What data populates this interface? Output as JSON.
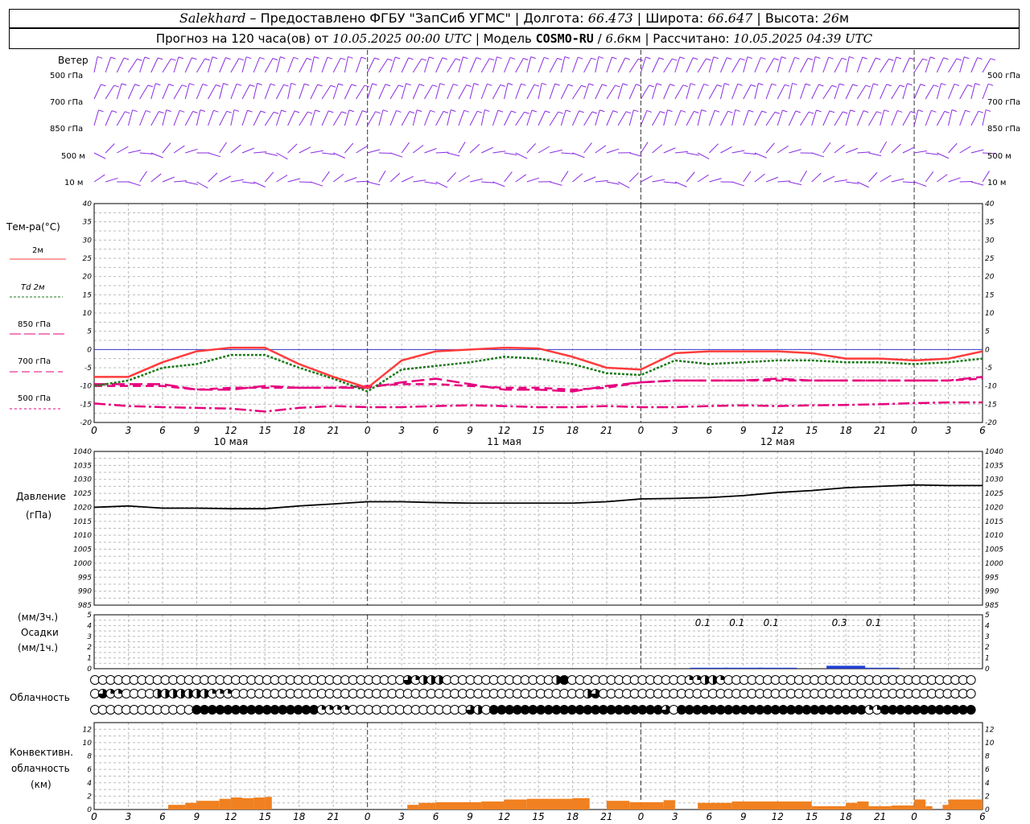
{
  "header": {
    "station": "Salekhard",
    "provider": "– Предоставлено ФГБУ \"ЗапСиб УГМС\"",
    "lon_label": "Долгота:",
    "lon_value": "66.473",
    "lat_label": "Широта:",
    "lat_value": "66.647",
    "alt_label": "Высота:",
    "alt_value": "26",
    "alt_unit": "м",
    "forecast_prefix": "Прогноз на 120 часа(ов) от",
    "forecast_start": "10.05.2025 00:00 UTC",
    "model_label": "Модель",
    "model_name": "COSMO-RU",
    "model_res": "6.6",
    "model_res_unit": "км",
    "calc_label": "Рассчитано:",
    "calc_time": "10.05.2025 04:39 UTC"
  },
  "labels": {
    "wind": "Ветер",
    "wind_levels": [
      "500 гПа",
      "700 гПа",
      "850 гПа",
      "500 м",
      "10 м"
    ],
    "temp_title": "Тем-ра(°С)",
    "temp_legend": [
      "2м",
      "Td  2м",
      "850 гПа",
      "700 гПа",
      "500 гПа"
    ],
    "pressure_title": "Давление",
    "pressure_unit": "(гПа)",
    "precip_3h": "(мм/3ч.)",
    "precip_title": "Осадки",
    "precip_1h": "(мм/1ч.)",
    "cloud_title": "Облачность",
    "conv_title": "Конвективн.",
    "conv_title2": "облачность",
    "conv_unit": "(км)"
  },
  "colors": {
    "wind": "#8a2be2",
    "t2m": "#ff3c3c",
    "td2m": "#1a7a1a",
    "t850": "#e6007e",
    "t700": "#e6007e",
    "t500": "#e6007e",
    "pressure": "#000000",
    "precip": "#1f3fd0",
    "conv": "#f08020",
    "zero": "#3a3ad0"
  },
  "chart_data": [
    {
      "type": "line",
      "title": "Тем-ра(°С)",
      "x_hours": [
        0,
        3,
        6,
        9,
        12,
        15,
        18,
        21,
        24,
        27,
        30,
        33,
        36,
        39,
        42,
        45,
        48,
        51,
        54,
        57,
        60,
        63,
        66,
        69,
        72,
        75,
        78
      ],
      "x_tick_labels": [
        "0",
        "3",
        "6",
        "9",
        "12",
        "15",
        "18",
        "21",
        "0",
        "3",
        "6",
        "9",
        "12",
        "15",
        "18",
        "21",
        "0",
        "3",
        "6",
        "9",
        "12",
        "15",
        "18",
        "21",
        "0",
        "3",
        "6"
      ],
      "day_labels": [
        "10 мая",
        "11 мая",
        "12 мая"
      ],
      "ylim": [
        -20,
        40
      ],
      "y_ticks": [
        -20,
        -15,
        -10,
        -5,
        0,
        5,
        10,
        15,
        20,
        25,
        30,
        35,
        40
      ],
      "series": [
        {
          "name": "2м",
          "values": [
            -7.5,
            -7.5,
            -3.5,
            -0.5,
            0.5,
            0.5,
            -4,
            -7.5,
            -10.5,
            -3,
            -0.5,
            0,
            0.5,
            0.3,
            -2,
            -5,
            -5.5,
            -1,
            -0.5,
            -0.5,
            -0.5,
            -1,
            -2.5,
            -2.5,
            -3,
            -2.5,
            -0.5
          ]
        },
        {
          "name": "Td  2м",
          "values": [
            -10,
            -8.5,
            -5,
            -4,
            -1.5,
            -1.5,
            -5,
            -8,
            -11.5,
            -5.5,
            -4.5,
            -3.5,
            -2,
            -2.5,
            -4,
            -6.5,
            -7,
            -3,
            -4,
            -3.5,
            -3,
            -3,
            -3.5,
            -3.5,
            -4,
            -3.5,
            -2.5
          ]
        },
        {
          "name": "850 гПа",
          "values": [
            -9.5,
            -9.5,
            -9.5,
            -11,
            -11,
            -10,
            -10.5,
            -10.5,
            -10.5,
            -9,
            -8,
            -9.5,
            -11,
            -11,
            -11.5,
            -10,
            -9,
            -8.5,
            -8.5,
            -8.5,
            -8,
            -8.5,
            -8.5,
            -8.5,
            -8.5,
            -8.5,
            -7.5
          ]
        },
        {
          "name": "700 гПа",
          "values": [
            -10,
            -10,
            -10,
            -11,
            -10.5,
            -10.5,
            -10.5,
            -10.5,
            -10,
            -9.5,
            -9.5,
            -10,
            -10.5,
            -10.5,
            -11,
            -10.5,
            -9,
            -8.5,
            -8.5,
            -8.5,
            -8.5,
            -8.5,
            -8.5,
            -8.5,
            -8.5,
            -8.5,
            -8
          ]
        },
        {
          "name": "500 гПа",
          "values": [
            -14.8,
            -15.5,
            -15.8,
            -16,
            -16.2,
            -17,
            -16,
            -15.5,
            -15.8,
            -15.8,
            -15.5,
            -15.3,
            -15.5,
            -15.8,
            -15.8,
            -15.5,
            -15.8,
            -15.8,
            -15.5,
            -15.3,
            -15.5,
            -15.3,
            -15.2,
            -15,
            -14.7,
            -14.5,
            -14.5
          ]
        }
      ]
    },
    {
      "type": "line",
      "title": "Давление",
      "ylabel": "(гПа)",
      "ylim": [
        985,
        1040
      ],
      "y_ticks": [
        985,
        990,
        995,
        1000,
        1005,
        1010,
        1015,
        1020,
        1025,
        1030,
        1035,
        1040
      ],
      "x_hours": [
        0,
        3,
        6,
        9,
        12,
        15,
        18,
        21,
        24,
        27,
        30,
        33,
        36,
        39,
        42,
        45,
        48,
        51,
        54,
        57,
        60,
        63,
        66,
        69,
        72,
        75,
        78
      ],
      "series": [
        {
          "name": "Давление",
          "values": [
            1020,
            1020.5,
            1019.7,
            1019.7,
            1019.5,
            1019.5,
            1020.5,
            1021.2,
            1022,
            1022,
            1021.7,
            1021.5,
            1021.5,
            1021.5,
            1021.5,
            1022,
            1023,
            1023.2,
            1023.5,
            1024.2,
            1025.3,
            1026,
            1027,
            1027.5,
            1028,
            1027.8,
            1027.8
          ]
        }
      ]
    },
    {
      "type": "bar",
      "title": "Осадки",
      "ylabel": "(мм/3ч.) (мм/1ч.)",
      "ylim": [
        0,
        5
      ],
      "y_ticks": [
        0,
        1,
        2,
        3,
        4,
        5
      ],
      "bars": [
        {
          "x": 54,
          "value": 0.1,
          "label": "0.1"
        },
        {
          "x": 57,
          "value": 0.1,
          "label": "0.1"
        },
        {
          "x": 60,
          "value": 0.1,
          "label": "0.1"
        },
        {
          "x": 66,
          "value": 0.3,
          "label": "0.3"
        },
        {
          "x": 69,
          "value": 0.1,
          "label": "0.1"
        }
      ]
    },
    {
      "type": "table",
      "title": "Облачность",
      "levels": [
        "high",
        "middle",
        "low"
      ],
      "pattern_high": "00000000000000000000000000000000000000003122200000000000000240000000000000001122100000000000000000000000000000000",
      "pattern_middle": "03110000222222211100000000000000000000000000000000000000000000023000000000000000000000000000000000000000000000000",
      "pattern_low": "00000000000004444444444444444111100000000000000032044444444444444444444443044444444444444444444444411444444444444"
    },
    {
      "type": "bar",
      "title": "Конвективн. облачность",
      "ylabel": "(км)",
      "ylim": [
        0,
        13
      ],
      "y_ticks": [
        0,
        2,
        4,
        6,
        8,
        10,
        12
      ],
      "segments": [
        {
          "x0": 6.5,
          "x1": 8,
          "value": 0.7
        },
        {
          "x0": 8,
          "x1": 9,
          "value": 1
        },
        {
          "x0": 9,
          "x1": 11,
          "value": 1.3
        },
        {
          "x0": 11,
          "x1": 12,
          "value": 1.6
        },
        {
          "x0": 12,
          "x1": 13,
          "value": 1.8
        },
        {
          "x0": 13,
          "x1": 14,
          "value": 1.7
        },
        {
          "x0": 14,
          "x1": 15,
          "value": 1.8
        },
        {
          "x0": 15,
          "x1": 15.6,
          "value": 1.9
        },
        {
          "x0": 27.5,
          "x1": 28.5,
          "value": 0.7
        },
        {
          "x0": 28.5,
          "x1": 30,
          "value": 1
        },
        {
          "x0": 30,
          "x1": 34,
          "value": 1.1
        },
        {
          "x0": 34,
          "x1": 36,
          "value": 1.2
        },
        {
          "x0": 36,
          "x1": 38,
          "value": 1.5
        },
        {
          "x0": 38,
          "x1": 42,
          "value": 1.6
        },
        {
          "x0": 42,
          "x1": 43.5,
          "value": 1.7
        },
        {
          "x0": 45,
          "x1": 47,
          "value": 1.3
        },
        {
          "x0": 47,
          "x1": 48,
          "value": 1.1
        },
        {
          "x0": 48,
          "x1": 50,
          "value": 1.1
        },
        {
          "x0": 50,
          "x1": 51,
          "value": 1.4
        },
        {
          "x0": 53,
          "x1": 56,
          "value": 1
        },
        {
          "x0": 56,
          "x1": 63,
          "value": 1.2
        },
        {
          "x0": 63,
          "x1": 66,
          "value": 0.5
        },
        {
          "x0": 66,
          "x1": 67,
          "value": 1
        },
        {
          "x0": 67,
          "x1": 68,
          "value": 1.2
        },
        {
          "x0": 68,
          "x1": 70,
          "value": 0.5
        },
        {
          "x0": 70,
          "x1": 72,
          "value": 0.6
        },
        {
          "x0": 72,
          "x1": 73,
          "value": 1.5
        },
        {
          "x0": 73,
          "x1": 73.6,
          "value": 0.5
        },
        {
          "x0": 74.5,
          "x1": 75,
          "value": 0.7
        },
        {
          "x0": 75,
          "x1": 78,
          "value": 1.5
        }
      ]
    }
  ]
}
